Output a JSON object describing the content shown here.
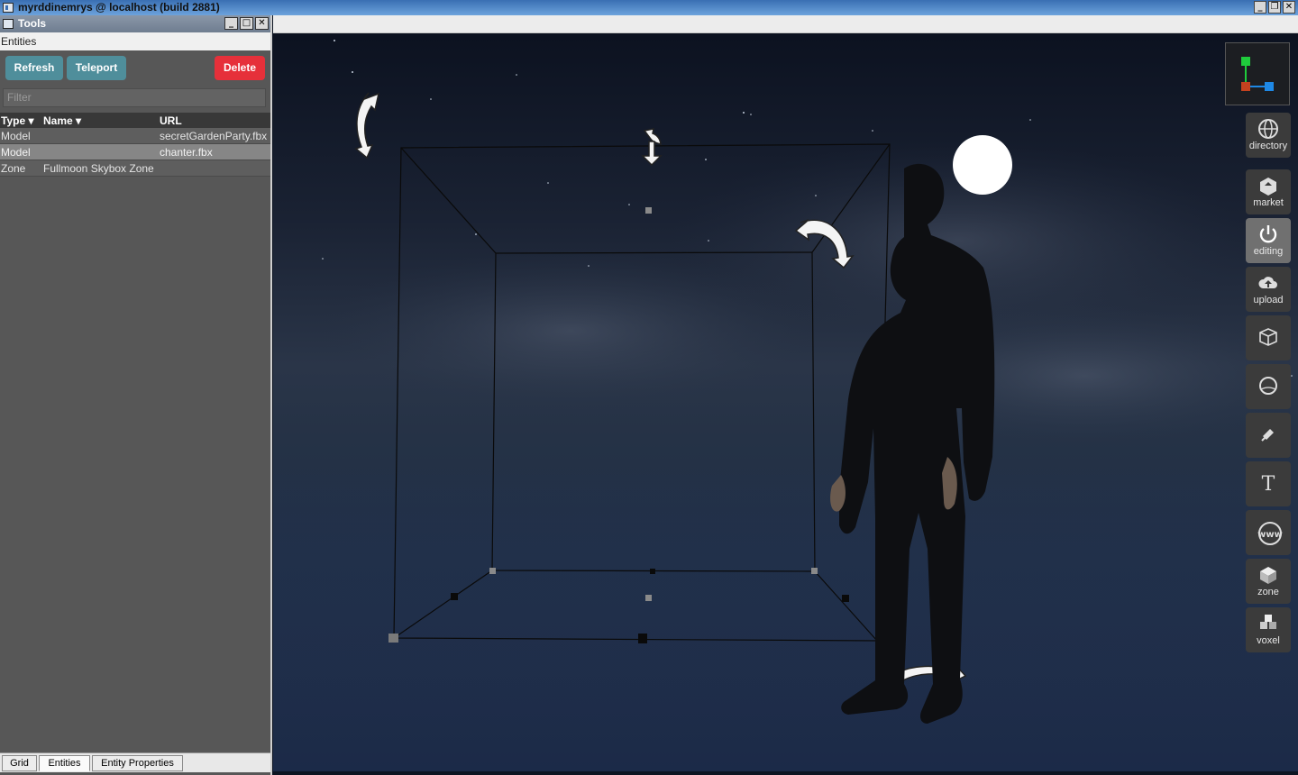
{
  "window": {
    "title": "myrddinemrys @ localhost (build 2881)",
    "controls": [
      "_",
      "❐",
      "✕"
    ]
  },
  "tools_panel": {
    "title": "Tools",
    "section_label": "Entities",
    "buttons": {
      "refresh": "Refresh",
      "teleport": "Teleport",
      "delete": "Delete"
    },
    "filter_placeholder": "Filter",
    "columns": [
      "Type ▾",
      "Name ▾",
      "URL"
    ],
    "rows": [
      {
        "type": "Model",
        "name": "",
        "url": "secretGardenParty.fbx"
      },
      {
        "type": "Model",
        "name": "",
        "url": "chanter.fbx"
      },
      {
        "type": "Zone",
        "name": "Fullmoon Skybox Zone",
        "url": ""
      }
    ],
    "tabs": [
      "Grid",
      "Entities",
      "Entity Properties"
    ],
    "active_tab": "Entities",
    "title_controls": [
      "_",
      "□",
      "✕"
    ]
  },
  "toolbar": {
    "items": [
      {
        "id": "directory",
        "label": "directory",
        "icon": "globe-icon"
      },
      {
        "id": "market",
        "label": "market",
        "icon": "market-box-icon"
      },
      {
        "id": "editing",
        "label": "editing",
        "icon": "power-icon",
        "active": true
      },
      {
        "id": "upload",
        "label": "upload",
        "icon": "cloud-upload-icon"
      },
      {
        "id": "cube",
        "label": "",
        "icon": "cube-icon"
      },
      {
        "id": "sphere",
        "label": "",
        "icon": "sphere-icon"
      },
      {
        "id": "light",
        "label": "",
        "icon": "light-icon"
      },
      {
        "id": "text",
        "label": "",
        "icon": "text-icon",
        "glyph": "T"
      },
      {
        "id": "web",
        "label": "",
        "icon": "www-icon",
        "glyph": "www"
      },
      {
        "id": "zone",
        "label": "zone",
        "icon": "zone-box-icon"
      },
      {
        "id": "voxel",
        "label": "voxel",
        "icon": "voxel-icon"
      }
    ]
  },
  "colors": {
    "refresh_button": "#4f8e9b",
    "delete_button": "#e6303a",
    "panel_bg": "#575757",
    "selected_row": "#868686",
    "toolbar_active": "#707070",
    "axis_green": "#1fcc3c",
    "axis_blue": "#1e88e5",
    "axis_red": "#c5421f"
  }
}
